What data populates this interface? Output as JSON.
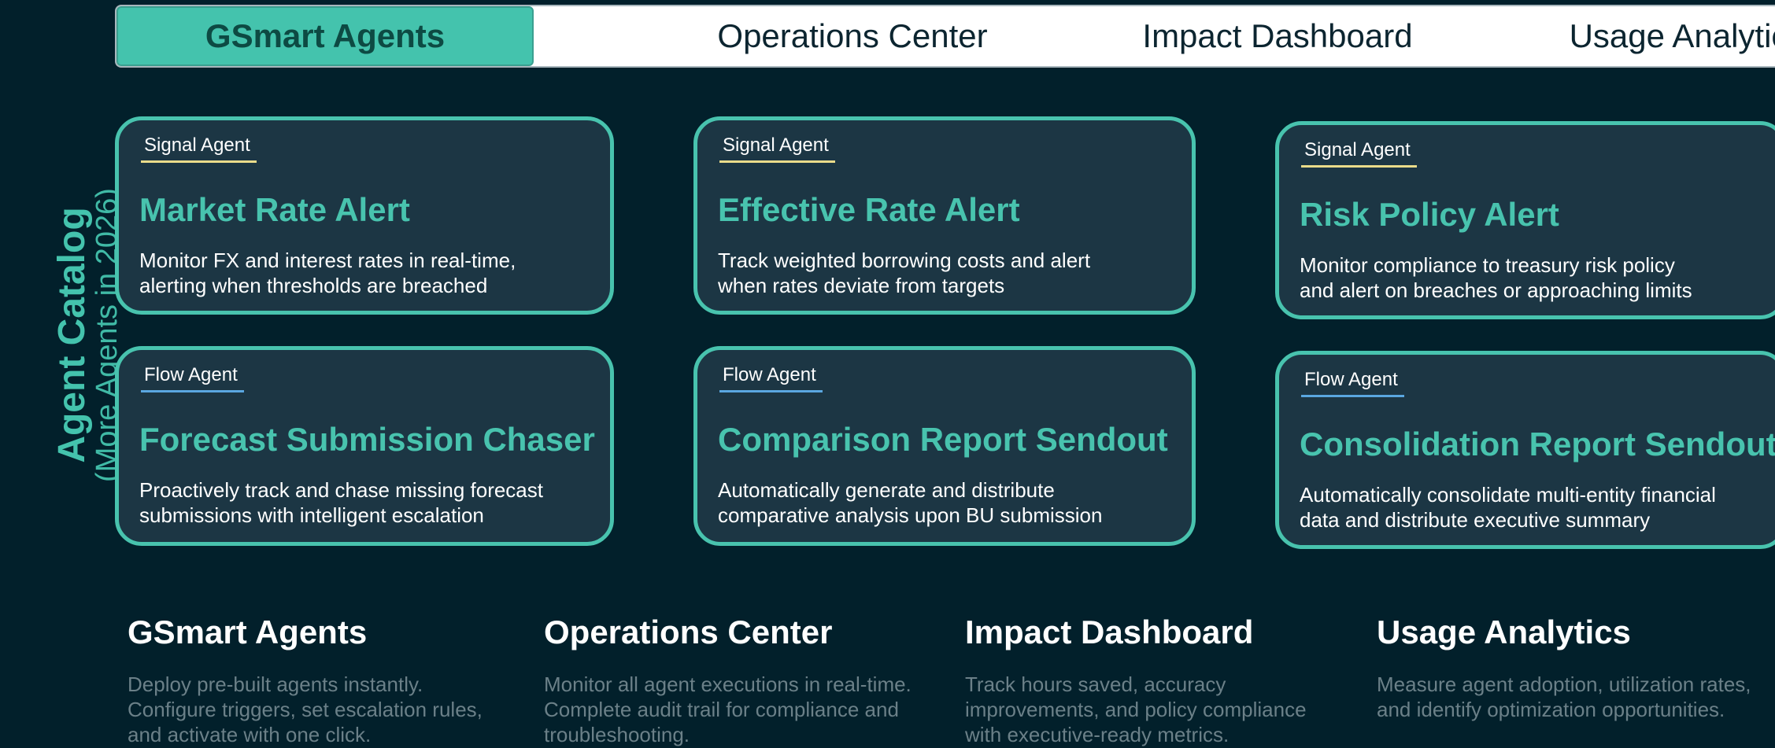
{
  "tabs": [
    {
      "label": "GSmart Agents",
      "active": true
    },
    {
      "label": "Operations Center",
      "active": false
    },
    {
      "label": "Impact Dashboard",
      "active": false
    },
    {
      "label": "Usage Analytics",
      "active": false
    }
  ],
  "side_label": {
    "title": "Agent Catalog",
    "subtitle": "(More Agents in 2026)"
  },
  "cards": [
    {
      "type": "Signal Agent",
      "title": "Market Rate Alert",
      "desc_line1": "Monitor FX and interest rates in real-time,",
      "desc_line2": "alerting when thresholds are breached"
    },
    {
      "type": "Signal Agent",
      "title": "Effective Rate Alert",
      "desc_line1": "Track weighted borrowing costs and alert",
      "desc_line2": "when rates deviate from targets"
    },
    {
      "type": "Signal Agent",
      "title": "Risk Policy Alert",
      "desc_line1": "Monitor compliance to treasury risk policy",
      "desc_line2": "and alert on breaches or approaching limits"
    },
    {
      "type": "Flow Agent",
      "title": "Forecast Submission Chaser",
      "desc_line1": "Proactively track and chase missing forecast",
      "desc_line2": "submissions with intelligent escalation"
    },
    {
      "type": "Flow Agent",
      "title": "Comparison Report Sendout",
      "desc_line1": "Automatically generate and distribute",
      "desc_line2": "comparative analysis upon BU submission"
    },
    {
      "type": "Flow Agent",
      "title": "Consolidation Report Sendout",
      "desc_line1": "Automatically consolidate multi-entity financial",
      "desc_line2": "data and distribute executive summary"
    }
  ],
  "features": [
    {
      "title": "GSmart Agents",
      "lines": [
        "Deploy pre-built agents instantly.",
        "Configure triggers, set escalation rules,",
        "and activate with one click."
      ]
    },
    {
      "title": "Operations Center",
      "lines": [
        "Monitor all agent executions in real-time.",
        "Complete audit trail for compliance and",
        "troubleshooting."
      ]
    },
    {
      "title": "Impact Dashboard",
      "lines": [
        "Track hours saved, accuracy",
        "improvements, and policy compliance",
        "with executive-ready metrics."
      ]
    },
    {
      "title": "Usage Analytics",
      "lines": [
        "Measure agent adoption, utilization rates,",
        "and identify optimization opportunities."
      ]
    }
  ],
  "colors": {
    "background": "#02202b",
    "accent": "#44c3ad",
    "card_bg": "#1c3644",
    "signal_underline": "#eadc8a",
    "flow_underline": "#5aa7e0"
  }
}
